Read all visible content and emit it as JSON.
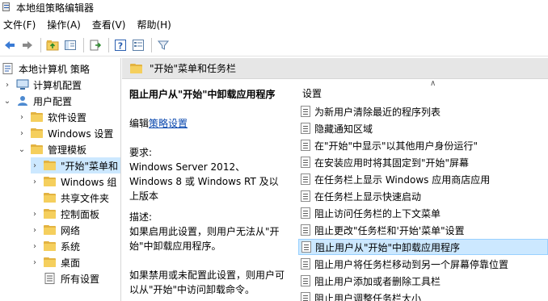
{
  "window": {
    "title": "本地组策略编辑器"
  },
  "menu": [
    "文件(F)",
    "操作(A)",
    "查看(V)",
    "帮助(H)"
  ],
  "toolbar": [
    "back-icon",
    "forward-icon",
    "up-folder-icon",
    "show-hide-tree-icon",
    "export-icon",
    "help-icon",
    "properties-icon",
    "filter-icon"
  ],
  "tree": {
    "root": "本地计算机 策略",
    "computer_config": "计算机配置",
    "user_config": "用户配置",
    "software_settings": "软件设置",
    "windows_settings": "Windows 设置",
    "admin_templates": "管理模板",
    "start_menu": "\"开始\"菜单和",
    "windows_components": "Windows 组",
    "shared_folders": "共享文件夹",
    "control_panel": "控制面板",
    "network": "网络",
    "system": "系统",
    "desktop": "桌面",
    "all_settings": "所有设置"
  },
  "header": {
    "title": "\"开始\"菜单和任务栏"
  },
  "description": {
    "title": "阻止用户从\"开始\"中卸载应用程序",
    "edit_prefix": "编辑",
    "edit_link": "策略设置",
    "requirements_label": "要求:",
    "requirements_text": "Windows Server 2012、Windows 8 或 Windows RT 及以上版本",
    "desc_label": "描述:",
    "desc_text": "如果启用此设置，则用户无法从\"开始\"中卸载应用程序。",
    "desc_text2": "如果禁用或未配置此设置，则用户可以从\"开始\"中访问卸载命令。"
  },
  "list": {
    "header": "设置",
    "items": [
      "为新用户清除最近的程序列表",
      "隐藏通知区域",
      "在\"开始\"中显示\"以其他用户身份运行\"",
      "在安装应用时将其固定到\"开始\"屏幕",
      "在任务栏上显示 Windows 应用商店应用",
      "在任务栏上显示快速启动",
      "阻止访问任务栏的上下文菜单",
      "阻止更改\"任务栏和'开始'菜单\"设置",
      "阻止用户从\"开始\"中卸载应用程序",
      "阻止用户将任务栏移动到另一个屏幕停靠位置",
      "阻止用户添加或者删除工具栏",
      "阻止用户调整任务栏大小"
    ],
    "selected_index": 8
  }
}
